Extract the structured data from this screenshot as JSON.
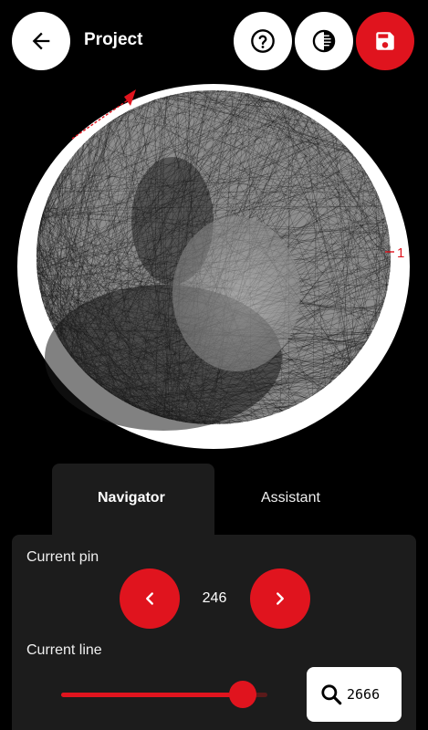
{
  "header": {
    "title": "Project",
    "back_icon": "arrow-left-icon",
    "help_icon": "question-circle-icon",
    "contrast_icon": "contrast-icon",
    "save_icon": "floppy-disk-icon"
  },
  "canvas": {
    "pin_marker_label": "1"
  },
  "tabs": [
    {
      "label": "Navigator",
      "active": true
    },
    {
      "label": "Assistant",
      "active": false
    }
  ],
  "navigator": {
    "current_pin_label": "Current pin",
    "current_pin_value": "246",
    "prev_icon": "chevron-left-icon",
    "next_icon": "chevron-right-icon",
    "current_line_label": "Current line",
    "current_line_value": "2666",
    "search_icon": "search-icon",
    "line_progress_fraction": 0.88
  },
  "colors": {
    "accent": "#e0141e",
    "background": "#000000",
    "panel": "#1c1c1c"
  }
}
